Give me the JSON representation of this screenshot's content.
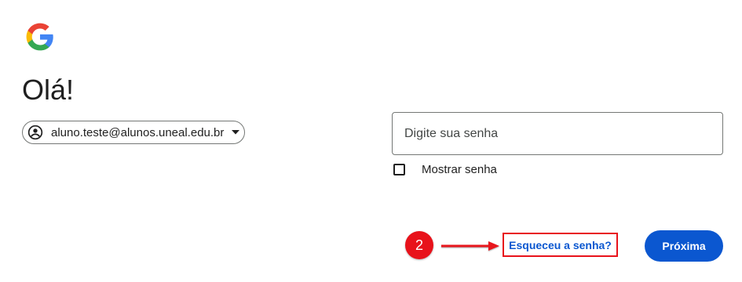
{
  "logo": {
    "icon": "google-g-icon",
    "colors": [
      "#4285F4",
      "#EA4335",
      "#FBBC05",
      "#34A853"
    ]
  },
  "page": {
    "title": "Olá!"
  },
  "account": {
    "email": "aluno.teste@alunos.uneal.edu.br",
    "avatar_icon": "account-circle-icon",
    "dropdown_icon": "caret-down-icon"
  },
  "password": {
    "placeholder": "Digite sua senha",
    "value": ""
  },
  "show_password": {
    "label": "Mostrar senha",
    "checked": false
  },
  "annotation": {
    "step_number": "2",
    "color": "#E8121B"
  },
  "forgot_password": {
    "label": "Esqueceu a senha?"
  },
  "next_button": {
    "label": "Próxima",
    "color": "#0B57D0"
  }
}
